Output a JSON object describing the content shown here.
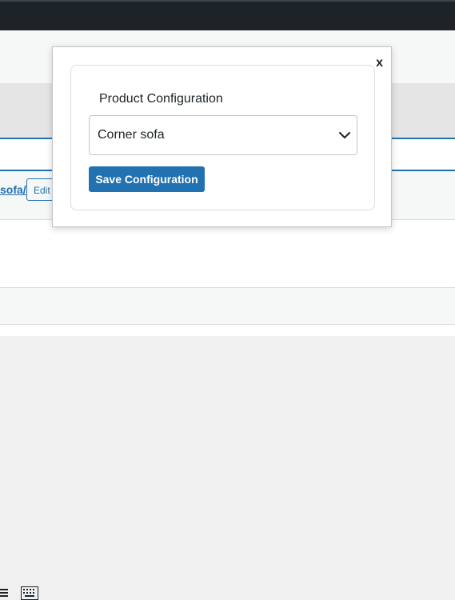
{
  "background": {
    "permalink_text": "sofa/",
    "edit_button_label": "Edit"
  },
  "modal": {
    "close_label": "x",
    "title": "Product Configuration",
    "select": {
      "selected": "Corner sofa"
    },
    "save_button_label": "Save Configuration"
  },
  "colors": {
    "admin_bar": "#1d2327",
    "accent": "#2271b1",
    "background": "#f0f0f1"
  },
  "toolbar": {
    "icons": [
      "list-icon",
      "keyboard-icon"
    ]
  }
}
